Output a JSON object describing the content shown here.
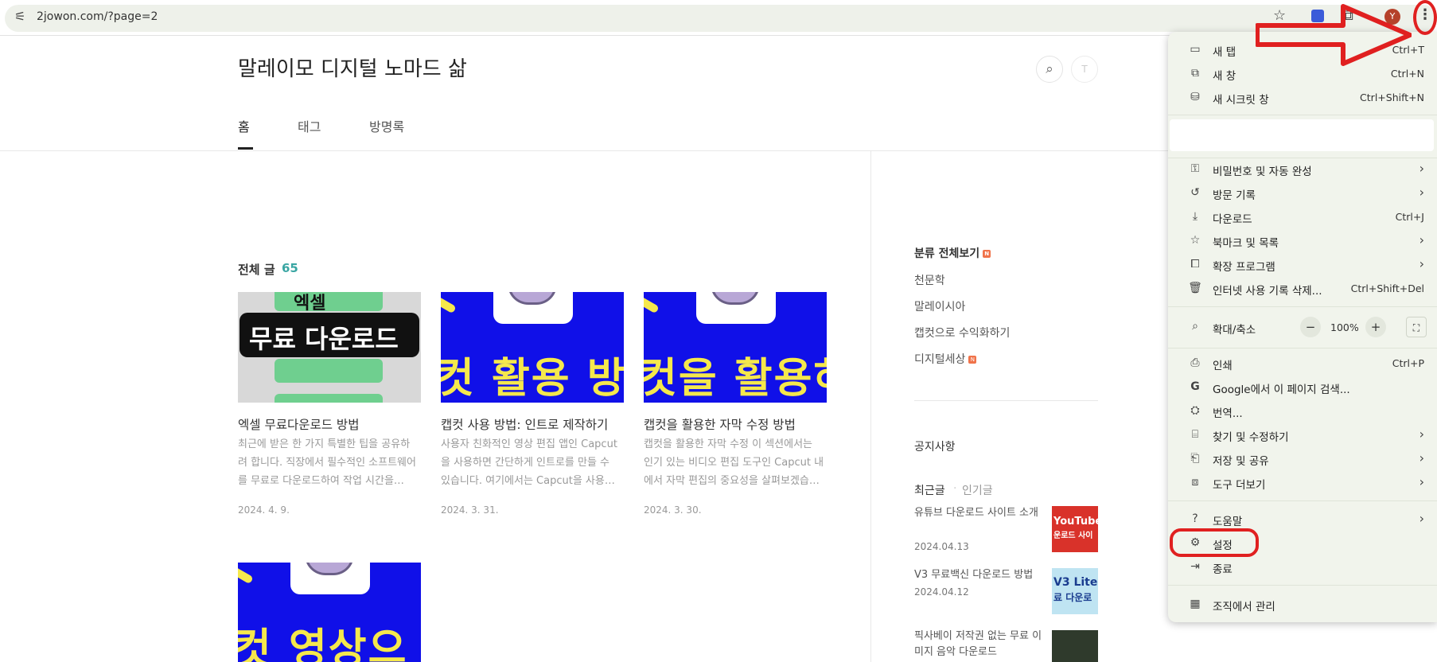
{
  "browser": {
    "url": "2jowon.com/?page=2",
    "avatar_letter": "Y"
  },
  "blog": {
    "title": "말레이모 디지털 노마드 삶",
    "nav": [
      "홈",
      "태그",
      "방명록"
    ],
    "total_label": "전체 글",
    "total_count": "65"
  },
  "posts": [
    {
      "title": "엑셀 무료다운로드 방법",
      "excerpt": "최근에 받은 한 가지 특별한 팁을 공유하려 합니다. 직장에서 필수적인 소프트웨어를 무료로 다운로드하여 작업 시간을…",
      "date": "2024. 4. 9.",
      "thumb_text_top": "엑셀",
      "thumb_text_main": "무료 다운로드"
    },
    {
      "title": "캡컷 사용 방법: 인트로 제작하기",
      "excerpt": "사용자 친화적인 영상 편집 앱인 Capcut을 사용하면 간단하게 인트로를 만들 수 있습니다. 여기에서는 Capcut을 사용…",
      "date": "2024. 3. 31.",
      "thumb_text_main": "컷 활용 방"
    },
    {
      "title": "캡컷을 활용한 자막 수정 방법",
      "excerpt": "캡컷을 활용한 자막 수정 이 섹션에서는 인기 있는 비디오 편집 도구인 Capcut 내에서 자막 편집의 중요성을 살펴보겠습…",
      "date": "2024. 3. 30.",
      "thumb_text_main": "컷을 활용하"
    },
    {
      "thumb_text_main": "컷 영상으"
    }
  ],
  "sidebar": {
    "categories_head": "분류 전체보기",
    "categories": [
      "천문학",
      "말레이시아",
      "캡컷으로 수익화하기",
      "디지털세상"
    ],
    "notice_head": "공지사항",
    "tab_recent": "최근글",
    "tab_popular": "인기글",
    "recent": [
      {
        "title": "유튜브 다운로드 사이트 소개",
        "date": "2024.04.13",
        "thumb_text": "YouTube",
        "thumb_text2": "운로드 사이"
      },
      {
        "title": "V3 무료백신 다운로드 방법",
        "date": "2024.04.12",
        "thumb_text": "V3 Lite",
        "thumb_text2": "료 다운로"
      },
      {
        "title": "픽사베이 저작권 없는 무료 이미지 음악 다운로드"
      }
    ]
  },
  "menu": {
    "new_tab": {
      "label": "새 탭",
      "shortcut": "Ctrl+T"
    },
    "new_window": {
      "label": "새 창",
      "shortcut": "Ctrl+N"
    },
    "incognito": {
      "label": "새 시크릿 창",
      "shortcut": "Ctrl+Shift+N"
    },
    "passwords": {
      "label": "비밀번호 및 자동 완성"
    },
    "history": {
      "label": "방문 기록"
    },
    "downloads": {
      "label": "다운로드",
      "shortcut": "Ctrl+J"
    },
    "bookmarks": {
      "label": "북마크 및 목록"
    },
    "extensions": {
      "label": "확장 프로그램"
    },
    "clear_data": {
      "label": "인터넷 사용 기록 삭제...",
      "shortcut": "Ctrl+Shift+Del"
    },
    "zoom": {
      "label": "확대/축소",
      "value": "100%",
      "minus": "−",
      "plus": "+"
    },
    "print": {
      "label": "인쇄",
      "shortcut": "Ctrl+P"
    },
    "google_search": {
      "label": "Google에서 이 페이지 검색..."
    },
    "translate": {
      "label": "번역..."
    },
    "find_edit": {
      "label": "찾기 및 수정하기"
    },
    "save_share": {
      "label": "저장 및 공유"
    },
    "more_tools": {
      "label": "도구 더보기"
    },
    "help": {
      "label": "도움말"
    },
    "settings": {
      "label": "설정"
    },
    "exit": {
      "label": "종료"
    },
    "managed": {
      "label": "조직에서 관리"
    }
  },
  "colors": {
    "accent_teal": "#3aa6a3",
    "annotation_red": "#e02020",
    "menu_bg": "#f1f4ec"
  }
}
